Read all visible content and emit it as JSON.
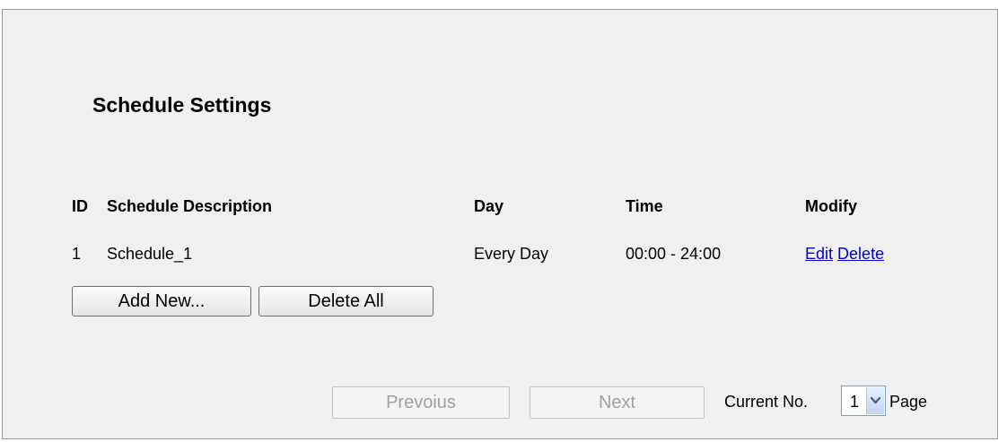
{
  "section": {
    "title": "Schedule Settings"
  },
  "table": {
    "headers": {
      "id": "ID",
      "description": "Schedule Description",
      "day": "Day",
      "time": "Time",
      "modify": "Modify"
    },
    "rows": [
      {
        "id": "1",
        "description": "Schedule_1",
        "day": "Every Day",
        "time": "00:00 - 24:00",
        "edit_label": "Edit",
        "delete_label": "Delete"
      }
    ]
  },
  "actions": {
    "add_new_label": "Add New...",
    "delete_all_label": "Delete All"
  },
  "pagination": {
    "previous_label": "Prevoius",
    "next_label": "Next",
    "current_label": "Current No.",
    "current_value": "1",
    "page_label": "Page"
  }
}
